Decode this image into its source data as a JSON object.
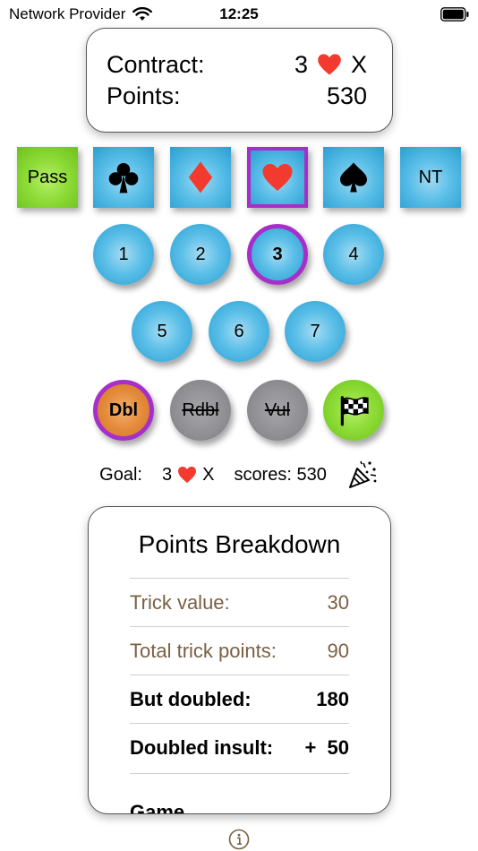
{
  "status_bar": {
    "carrier": "Network Provider",
    "time": "12:25"
  },
  "contract": {
    "contract_label": "Contract:",
    "contract_level": "3",
    "contract_suit_icon": "heart-icon",
    "contract_double": "X",
    "points_label": "Points:",
    "points_value": "530"
  },
  "suits": [
    {
      "label": "Pass",
      "icon": null
    },
    {
      "label": "",
      "icon": "club-icon"
    },
    {
      "label": "",
      "icon": "diamond-icon"
    },
    {
      "label": "",
      "icon": "heart-icon",
      "selected": true
    },
    {
      "label": "",
      "icon": "spade-icon"
    },
    {
      "label": "NT",
      "icon": null
    }
  ],
  "levels": [
    "1",
    "2",
    "3",
    "4",
    "5",
    "6",
    "7"
  ],
  "selected_level": "3",
  "modifiers": {
    "double": "Dbl",
    "redouble": "Rdbl",
    "vulnerable": "Vul",
    "finish_icon": "checkered-flag-icon"
  },
  "goal": {
    "label": "Goal:",
    "level": "3",
    "suit_icon": "heart-icon",
    "double": "X",
    "scores_label": "scores: 530",
    "celebrate_icon": "party-popper-icon"
  },
  "breakdown": {
    "title": "Points Breakdown",
    "rows": [
      {
        "label": "Trick value:",
        "value": "30"
      },
      {
        "label": "Total trick points:",
        "value": "90"
      },
      {
        "label": "But doubled:",
        "value": "180"
      },
      {
        "label": "Doubled insult:",
        "value": "+  50"
      },
      {
        "label": "Game",
        "value": ""
      }
    ]
  },
  "colors": {
    "accent_blue": "#2a9ed2",
    "pass_green": "#8fdc38",
    "selection_purple": "#a62fc9",
    "double_orange": "#e58c3c",
    "disabled_grey": "#8e8e93",
    "heart_red": "#f23a2f",
    "soft_text": "#7a6044"
  }
}
